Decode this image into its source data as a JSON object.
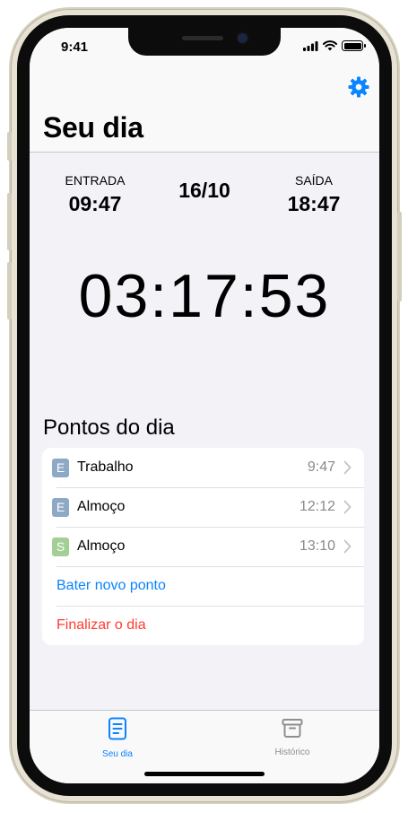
{
  "status_bar": {
    "time": "9:41"
  },
  "header": {
    "title": "Seu dia"
  },
  "summary": {
    "entrada_label": "ENTRADA",
    "entrada_time": "09:47",
    "date": "16/10",
    "saida_label": "SAÍDA",
    "saida_time": "18:47"
  },
  "timer": "03:17:53",
  "section": {
    "title": "Pontos do dia"
  },
  "entries": [
    {
      "badge": "E",
      "badge_color": "#8ea9c5",
      "name": "Trabalho",
      "time": "9:47"
    },
    {
      "badge": "E",
      "badge_color": "#8ea9c5",
      "name": "Almoço",
      "time": "12:12"
    },
    {
      "badge": "S",
      "badge_color": "#a3cf96",
      "name": "Almoço",
      "time": "13:10"
    }
  ],
  "actions": {
    "new_point": "Bater novo ponto",
    "new_point_color": "#0a84ff",
    "finish_day": "Finalizar o dia",
    "finish_day_color": "#ff3b30"
  },
  "tabs": [
    {
      "label": "Seu dia",
      "icon": "document-icon",
      "active": true
    },
    {
      "label": "Histórico",
      "icon": "archive-box-icon",
      "active": false
    }
  ],
  "colors": {
    "accent": "#0a84ff",
    "inactive_tab": "#8e8e93"
  }
}
